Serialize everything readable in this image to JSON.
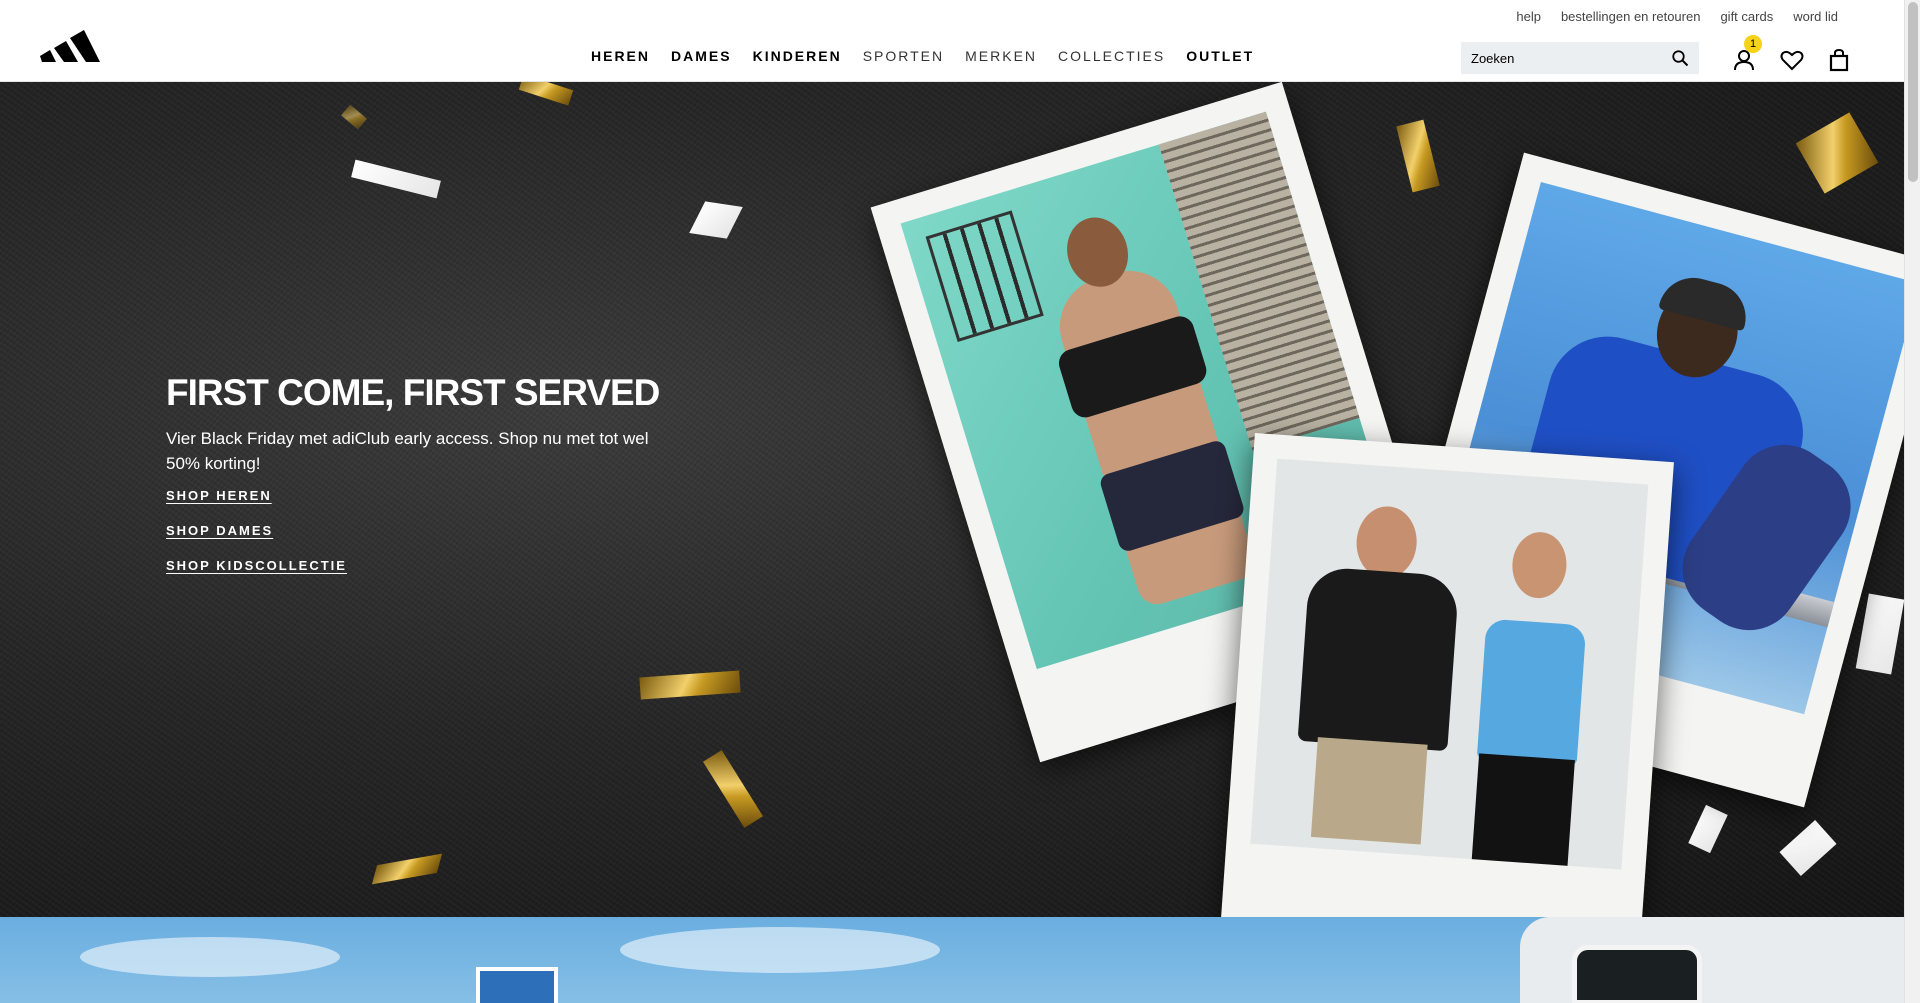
{
  "utility_links": [
    "help",
    "bestellingen en retouren",
    "gift cards",
    "word lid"
  ],
  "nav": {
    "items": [
      {
        "label": "HEREN",
        "style": "bold"
      },
      {
        "label": "DAMES",
        "style": "bold"
      },
      {
        "label": "KINDEREN",
        "style": "bold"
      },
      {
        "label": "SPORTEN",
        "style": "light"
      },
      {
        "label": "MERKEN",
        "style": "light"
      },
      {
        "label": "COLLECTIES",
        "style": "light"
      },
      {
        "label": "OUTLET",
        "style": "bold"
      }
    ]
  },
  "search": {
    "placeholder": "Zoeken"
  },
  "account": {
    "badge_count": "1"
  },
  "hero": {
    "title": "FIRST COME, FIRST SERVED",
    "subtitle": "Vier Black Friday met adiClub early access. Shop nu met tot wel 50% korting!",
    "links": [
      "SHOP HEREN",
      "SHOP DAMES",
      "SHOP KIDSCOLLECTIE"
    ]
  },
  "colors": {
    "badge": "#f7d21a",
    "search_bg": "#eceff1",
    "hero_bg": "#262626"
  },
  "icons": [
    "adidas-logo",
    "search-icon",
    "user-icon",
    "heart-icon",
    "bag-icon"
  ]
}
